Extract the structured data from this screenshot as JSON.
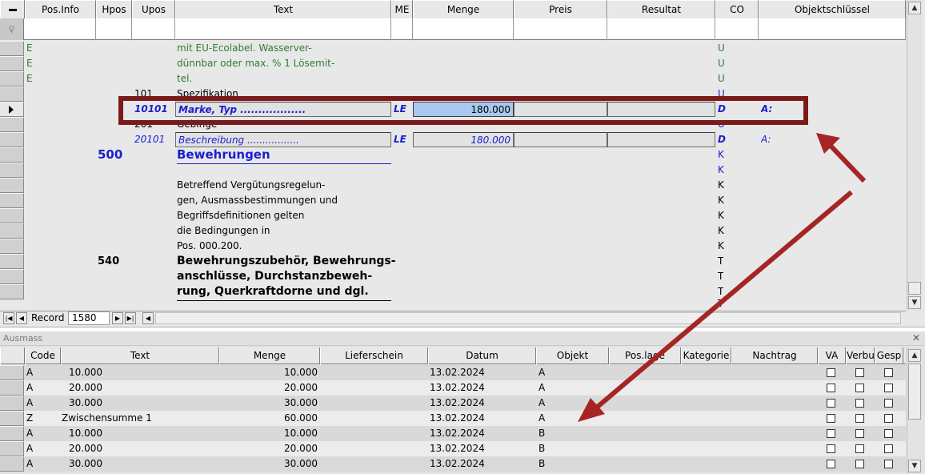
{
  "upper": {
    "columns": [
      "",
      "Pos.Info",
      "Hpos",
      "Upos",
      "Text",
      "ME",
      "Menge",
      "Preis",
      "Resultat",
      "CO",
      "Objektschlüssel"
    ],
    "rows": [
      {
        "info": "E",
        "text": "mit EU-Ecolabel. Wasserver-",
        "co": "U"
      },
      {
        "info": "E",
        "text": "dünnbar oder max. % 1 Lösemit-",
        "co": "U"
      },
      {
        "info": "E",
        "text": "tel.",
        "co": "U"
      },
      {
        "upos": "101",
        "text": "Spezifikation",
        "co": "U"
      },
      {
        "upos": "10101",
        "text": "Marke, Typ ..................",
        "me": "LE",
        "menge": "180.000",
        "co": "D",
        "obj": "A:"
      },
      {
        "upos": "201",
        "text": "Gebinge",
        "co": "U"
      },
      {
        "upos": "20101",
        "text": "Beschreibung .................",
        "me": "LE",
        "menge": "180.000",
        "co": "D",
        "obj": "A:"
      },
      {
        "hpos": "500",
        "text": "Bewehrungen",
        "co": "K"
      },
      {
        "text": "",
        "co": "K"
      },
      {
        "text": "Betreffend Vergütungsregelun-",
        "co": "K"
      },
      {
        "text": "gen, Ausmassbestimmungen und",
        "co": "K"
      },
      {
        "text": "Begriffsdefinitionen gelten",
        "co": "K"
      },
      {
        "text": "die Bedingungen in",
        "co": "K"
      },
      {
        "text": "Pos. 000.200.",
        "co": "K"
      },
      {
        "hpos": "540",
        "text": "Bewehrungszubehör, Bewehrungs-",
        "co": "T"
      },
      {
        "text": "anschlüsse, Durchstanzbeweh-",
        "co": "T"
      },
      {
        "text": "rung, Querkraftdorne und dgl.",
        "co": "T"
      },
      {
        "text": "",
        "co": "T"
      }
    ],
    "nav": {
      "label": "Record",
      "value": "1580"
    }
  },
  "lower": {
    "title": "Ausmass",
    "columns": [
      "",
      "Code",
      "Text",
      "Menge",
      "Lieferschein",
      "Datum",
      "Objekt",
      "Pos.lage",
      "Kategorie",
      "Nachtrag",
      "VA",
      "Verbu",
      "Gesp"
    ],
    "rows": [
      {
        "code": "A",
        "text": "10.000",
        "menge": "10.000",
        "datum": "13.02.2024",
        "objekt": "A"
      },
      {
        "code": "A",
        "text": "20.000",
        "menge": "20.000",
        "datum": "13.02.2024",
        "objekt": "A"
      },
      {
        "code": "A",
        "text": "30.000",
        "menge": "30.000",
        "datum": "13.02.2024",
        "objekt": "A"
      },
      {
        "code": "Z",
        "text": "Zwischensumme 1",
        "menge": "60.000",
        "datum": "13.02.2024",
        "objekt": "A"
      },
      {
        "code": "A",
        "text": "10.000",
        "menge": "10.000",
        "datum": "13.02.2024",
        "objekt": "B"
      },
      {
        "code": "A",
        "text": "20.000",
        "menge": "20.000",
        "datum": "13.02.2024",
        "objekt": "B"
      },
      {
        "code": "A",
        "text": "30.000",
        "menge": "30.000",
        "datum": "13.02.2024",
        "objekt": "B"
      }
    ]
  },
  "colors": {
    "annotation": "#7b1a1a",
    "selected_cell": "#a9c8f0",
    "green_text": "#2e7d32",
    "blue_text": "#1a20d0"
  }
}
